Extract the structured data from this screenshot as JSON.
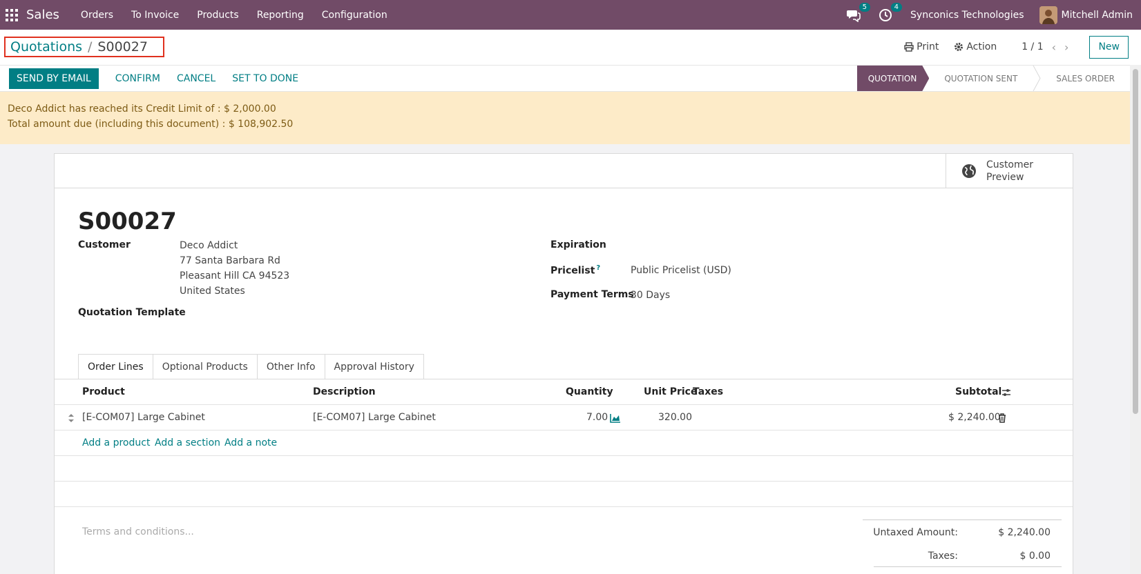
{
  "navbar": {
    "app_name": "Sales",
    "menu": [
      "Orders",
      "To Invoice",
      "Products",
      "Reporting",
      "Configuration"
    ],
    "messages_count": "5",
    "activities_count": "4",
    "company": "Synconics Technologies",
    "user": "Mitchell Admin"
  },
  "control": {
    "breadcrumb_parent": "Quotations",
    "breadcrumb_separator": "/",
    "breadcrumb_current": "S00027",
    "print_label": "Print",
    "action_label": "Action",
    "pager": "1 / 1",
    "new_label": "New"
  },
  "statusbar": {
    "buttons": [
      "SEND BY EMAIL",
      "CONFIRM",
      "CANCEL",
      "SET TO DONE"
    ],
    "stages": [
      "QUOTATION",
      "QUOTATION SENT",
      "SALES ORDER"
    ],
    "active_stage": "QUOTATION"
  },
  "alert": {
    "line1": "Deco Addict has reached its Credit Limit of : $ 2,000.00",
    "line2": "Total amount due (including this document) : $ 108,902.50"
  },
  "sheet": {
    "customer_preview_line1": "Customer",
    "customer_preview_line2": "Preview",
    "title": "S00027",
    "customer_label": "Customer",
    "customer_name": "Deco Addict",
    "customer_street": "77 Santa Barbara Rd",
    "customer_city": "Pleasant Hill CA 94523",
    "customer_country": "United States",
    "quotation_template_label": "Quotation Template",
    "expiration_label": "Expiration",
    "pricelist_label": "Pricelist",
    "pricelist_help": "?",
    "pricelist_value": "Public Pricelist (USD)",
    "payment_terms_label": "Payment Terms",
    "payment_terms_value": "30 Days"
  },
  "tabs": [
    "Order Lines",
    "Optional Products",
    "Other Info",
    "Approval History"
  ],
  "order_lines": {
    "headers": {
      "product": "Product",
      "description": "Description",
      "quantity": "Quantity",
      "unit_price": "Unit Price",
      "taxes": "Taxes",
      "subtotal": "Subtotal"
    },
    "rows": [
      {
        "product": "[E-COM07] Large Cabinet",
        "description": "[E-COM07] Large Cabinet",
        "quantity": "7.00",
        "unit_price": "320.00",
        "taxes": "",
        "subtotal": "$ 2,240.00"
      }
    ],
    "add_product": "Add a product",
    "add_section": "Add a section",
    "add_note": "Add a note"
  },
  "footer": {
    "terms_placeholder": "Terms and conditions...",
    "untaxed_label": "Untaxed Amount:",
    "untaxed_value": "$ 2,240.00",
    "taxes_label": "Taxes:",
    "taxes_value": "$ 0.00"
  },
  "colors": {
    "brand": "#714b67",
    "accent": "#017e84",
    "alert_bg": "#fdebc8"
  }
}
